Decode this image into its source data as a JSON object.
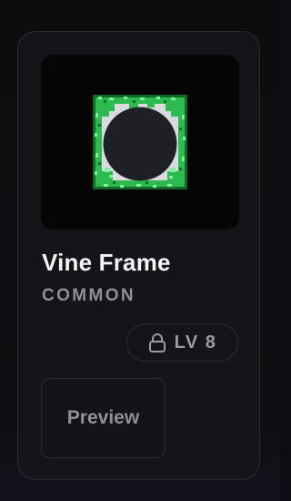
{
  "item": {
    "name": "Vine Frame",
    "rarity": "COMMON",
    "level": "LV 8",
    "preview_label": "Preview"
  },
  "icons": {
    "lock": "lock-icon",
    "frame": "vine-frame-icon"
  },
  "colors": {
    "card_bg": "#151519",
    "card_border": "#2b2c33",
    "thumb_bg": "#050506",
    "title": "#f4f4f6",
    "muted": "#8e8f97",
    "vine_green": "#2dbb4f",
    "vine_dark": "#0f6b27",
    "vine_light": "#7ff29a"
  }
}
